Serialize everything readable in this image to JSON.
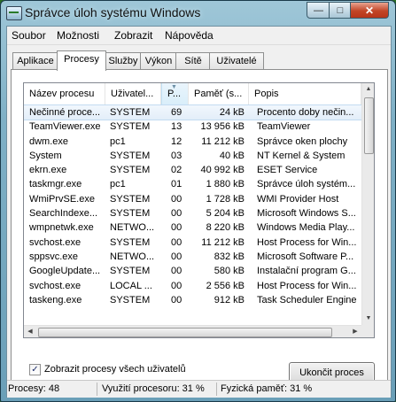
{
  "window": {
    "title": "Správce úloh systému Windows",
    "min_icon": "minimize-icon",
    "max_icon": "maximize-icon",
    "close_icon": "close-icon"
  },
  "menu": [
    "Soubor",
    "Možnosti",
    "Zobrazit",
    "Nápověda"
  ],
  "tabs": [
    "Aplikace",
    "Procesy",
    "Služby",
    "Výkon",
    "Sítě",
    "Uživatelé"
  ],
  "active_tab": "Procesy",
  "columns": [
    "Název procesu",
    "Uživatel...",
    "P...",
    "Paměť (s...",
    "Popis"
  ],
  "sorted_column": "P...",
  "processes": [
    [
      "Nečinné proce...",
      "SYSTEM",
      "69",
      "24 kB",
      "Procento doby nečin..."
    ],
    [
      "TeamViewer.exe",
      "SYSTEM",
      "13",
      "13 956 kB",
      "TeamViewer"
    ],
    [
      "dwm.exe",
      "pc1",
      "12",
      "11 212 kB",
      "Správce oken plochy"
    ],
    [
      "System",
      "SYSTEM",
      "03",
      "40 kB",
      "NT Kernel & System"
    ],
    [
      "ekrn.exe",
      "SYSTEM",
      "02",
      "40 992 kB",
      "ESET Service"
    ],
    [
      "taskmgr.exe",
      "pc1",
      "01",
      "1 880 kB",
      "Správce úloh systém..."
    ],
    [
      "WmiPrvSE.exe",
      "SYSTEM",
      "00",
      "1 728 kB",
      "WMI Provider Host"
    ],
    [
      "SearchIndexe...",
      "SYSTEM",
      "00",
      "5 204 kB",
      "Microsoft Windows S..."
    ],
    [
      "wmpnetwk.exe",
      "NETWO...",
      "00",
      "8 220 kB",
      "Windows Media Play..."
    ],
    [
      "svchost.exe",
      "SYSTEM",
      "00",
      "11 212 kB",
      "Host Process for Win..."
    ],
    [
      "sppsvc.exe",
      "NETWO...",
      "00",
      "832 kB",
      "Microsoft Software P..."
    ],
    [
      "GoogleUpdate...",
      "SYSTEM",
      "00",
      "580 kB",
      "Instalační program G..."
    ],
    [
      "svchost.exe",
      "LOCAL ...",
      "00",
      "2 556 kB",
      "Host Process for Win..."
    ],
    [
      "taskeng.exe",
      "SYSTEM",
      "00",
      "912 kB",
      "Task Scheduler Engine"
    ]
  ],
  "show_all_users": {
    "label": "Zobrazit procesy všech uživatelů",
    "checked": true
  },
  "end_process_button": "Ukončit proces",
  "status": {
    "processes": "Procesy: 48",
    "cpu": "Využití procesoru: 31 %",
    "memory": "Fyzická paměť: 31 %"
  }
}
